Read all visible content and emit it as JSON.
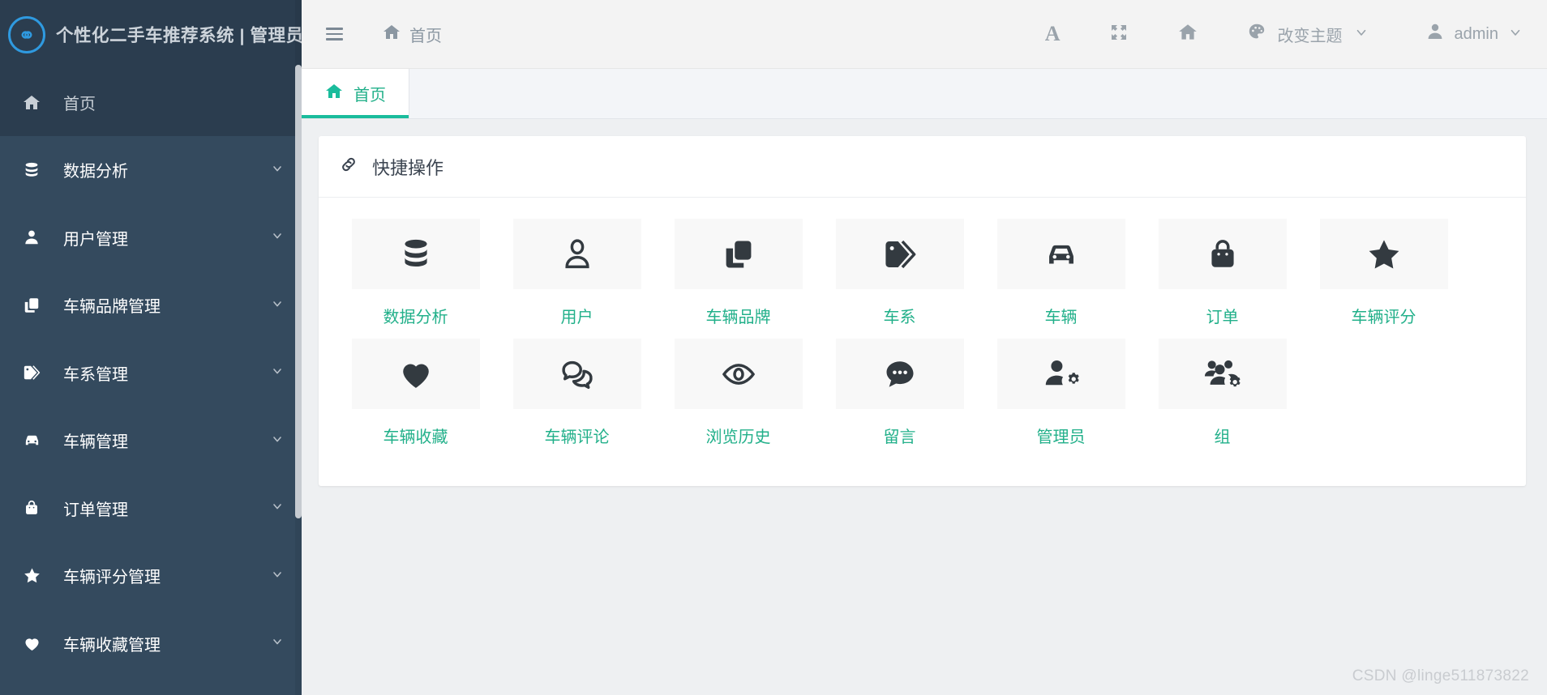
{
  "sidebar": {
    "logo_icon": "infinity-circle-logo",
    "title": "个性化二手车推荐系统 | 管理员",
    "home": {
      "label": "首页",
      "icon": "home-icon"
    },
    "items": [
      {
        "label": "数据分析",
        "icon": "database-icon",
        "chevron": "chevron-down-icon"
      },
      {
        "label": "用户管理",
        "icon": "user-icon",
        "chevron": "chevron-down-icon"
      },
      {
        "label": "车辆品牌管理",
        "icon": "copy-icon",
        "chevron": "chevron-down-icon"
      },
      {
        "label": "车系管理",
        "icon": "tag-icon",
        "chevron": "chevron-down-icon"
      },
      {
        "label": "车辆管理",
        "icon": "car-icon",
        "chevron": "chevron-down-icon"
      },
      {
        "label": "订单管理",
        "icon": "bag-icon",
        "chevron": "chevron-down-icon"
      },
      {
        "label": "车辆评分管理",
        "icon": "star-icon",
        "chevron": "chevron-down-icon"
      },
      {
        "label": "车辆收藏管理",
        "icon": "heart-icon",
        "chevron": "chevron-down-icon"
      }
    ]
  },
  "topbar": {
    "menu_toggle": "hamburger-icon",
    "breadcrumb": "首页",
    "breadcrumb_icon": "home-icon",
    "tools": [
      {
        "name": "font-size-button",
        "glyph": "A"
      },
      {
        "name": "fullscreen-button",
        "glyph": "expand"
      },
      {
        "name": "home-button",
        "glyph": "home"
      }
    ],
    "theme": {
      "label": "改变主题",
      "icon": "palette-icon",
      "chevron": "chevron-down-icon"
    },
    "user": {
      "label": "admin",
      "icon": "user-icon",
      "chevron": "chevron-down-icon"
    }
  },
  "tabs": [
    {
      "label": "首页",
      "icon": "home-icon",
      "active": true
    }
  ],
  "card": {
    "title": "快捷操作",
    "icon": "link-icon",
    "tiles": [
      {
        "label": "数据分析",
        "icon": "database-icon"
      },
      {
        "label": "用户",
        "icon": "user-icon"
      },
      {
        "label": "车辆品牌",
        "icon": "copy-icon"
      },
      {
        "label": "车系",
        "icon": "tag-icon"
      },
      {
        "label": "车辆",
        "icon": "car-icon"
      },
      {
        "label": "订单",
        "icon": "bag-icon"
      },
      {
        "label": "车辆评分",
        "icon": "star-icon"
      },
      {
        "label": "车辆收藏",
        "icon": "heart-icon"
      },
      {
        "label": "车辆评论",
        "icon": "comments-icon"
      },
      {
        "label": "浏览历史",
        "icon": "eye-icon"
      },
      {
        "label": "留言",
        "icon": "comment-dots-icon"
      },
      {
        "label": "管理员",
        "icon": "user-cog-icon"
      },
      {
        "label": "组",
        "icon": "users-cog-icon"
      }
    ]
  },
  "watermark": "CSDN @linge511873822",
  "colors": {
    "sidebar_bg": "#344a5e",
    "sidebar_header_bg": "#2b3d4f",
    "accent_green": "#1abc9c",
    "logo_blue": "#2f9ae0",
    "topbar_bg": "#f3f3f3",
    "content_bg": "#eef0f2"
  }
}
